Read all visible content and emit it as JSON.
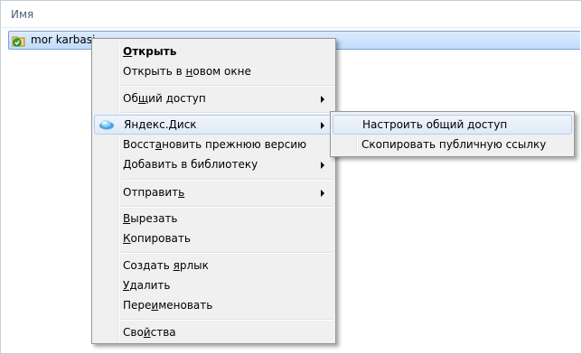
{
  "header": {
    "column_name": "Имя"
  },
  "file": {
    "name": "mor karbasi",
    "icon": "folder-sync-check-icon"
  },
  "context_menu": {
    "items": [
      {
        "key": "open",
        "before": "",
        "accel": "О",
        "after": "ткрыть",
        "bold": true
      },
      {
        "key": "open_new_window",
        "before": "Открыть в ",
        "accel": "н",
        "after": "овом окне"
      },
      {
        "key": "share",
        "before": "Об",
        "accel": "щ",
        "after": "ий доступ",
        "submenu": true
      },
      {
        "key": "yandex_disk",
        "before": "",
        "accel": "",
        "after": "Яндекс.Диск",
        "submenu": true,
        "highlighted": true,
        "icon": "yandex-disk-icon"
      },
      {
        "key": "restore",
        "before": "Восст",
        "accel": "а",
        "after": "новить прежнюю версию"
      },
      {
        "key": "add_library",
        "before": "",
        "accel": "Д",
        "after": "обавить в библиотеку",
        "submenu": true
      },
      {
        "key": "send_to",
        "before": "Отправит",
        "accel": "ь",
        "after": "",
        "submenu": true
      },
      {
        "key": "cut",
        "before": "",
        "accel": "В",
        "after": "ырезать"
      },
      {
        "key": "copy",
        "before": "",
        "accel": "К",
        "after": "опировать"
      },
      {
        "key": "create_shortcut",
        "before": "Создать ",
        "accel": "я",
        "after": "рлык"
      },
      {
        "key": "delete",
        "before": "",
        "accel": "У",
        "after": "далить"
      },
      {
        "key": "rename",
        "before": "Пере",
        "accel": "и",
        "after": "меновать"
      },
      {
        "key": "properties",
        "before": "Сво",
        "accel": "й",
        "after": "ства"
      }
    ]
  },
  "submenu": {
    "items": [
      {
        "key": "configure_sharing",
        "label": "Настроить общий доступ",
        "highlighted": true
      },
      {
        "key": "copy_public_link",
        "label": "Скопировать публичную ссылку"
      }
    ]
  },
  "colors": {
    "selection": "#c1dcfc",
    "menu_bg": "#f0f0f0",
    "highlight_border": "#aecff7",
    "header_text": "#4c607a"
  }
}
